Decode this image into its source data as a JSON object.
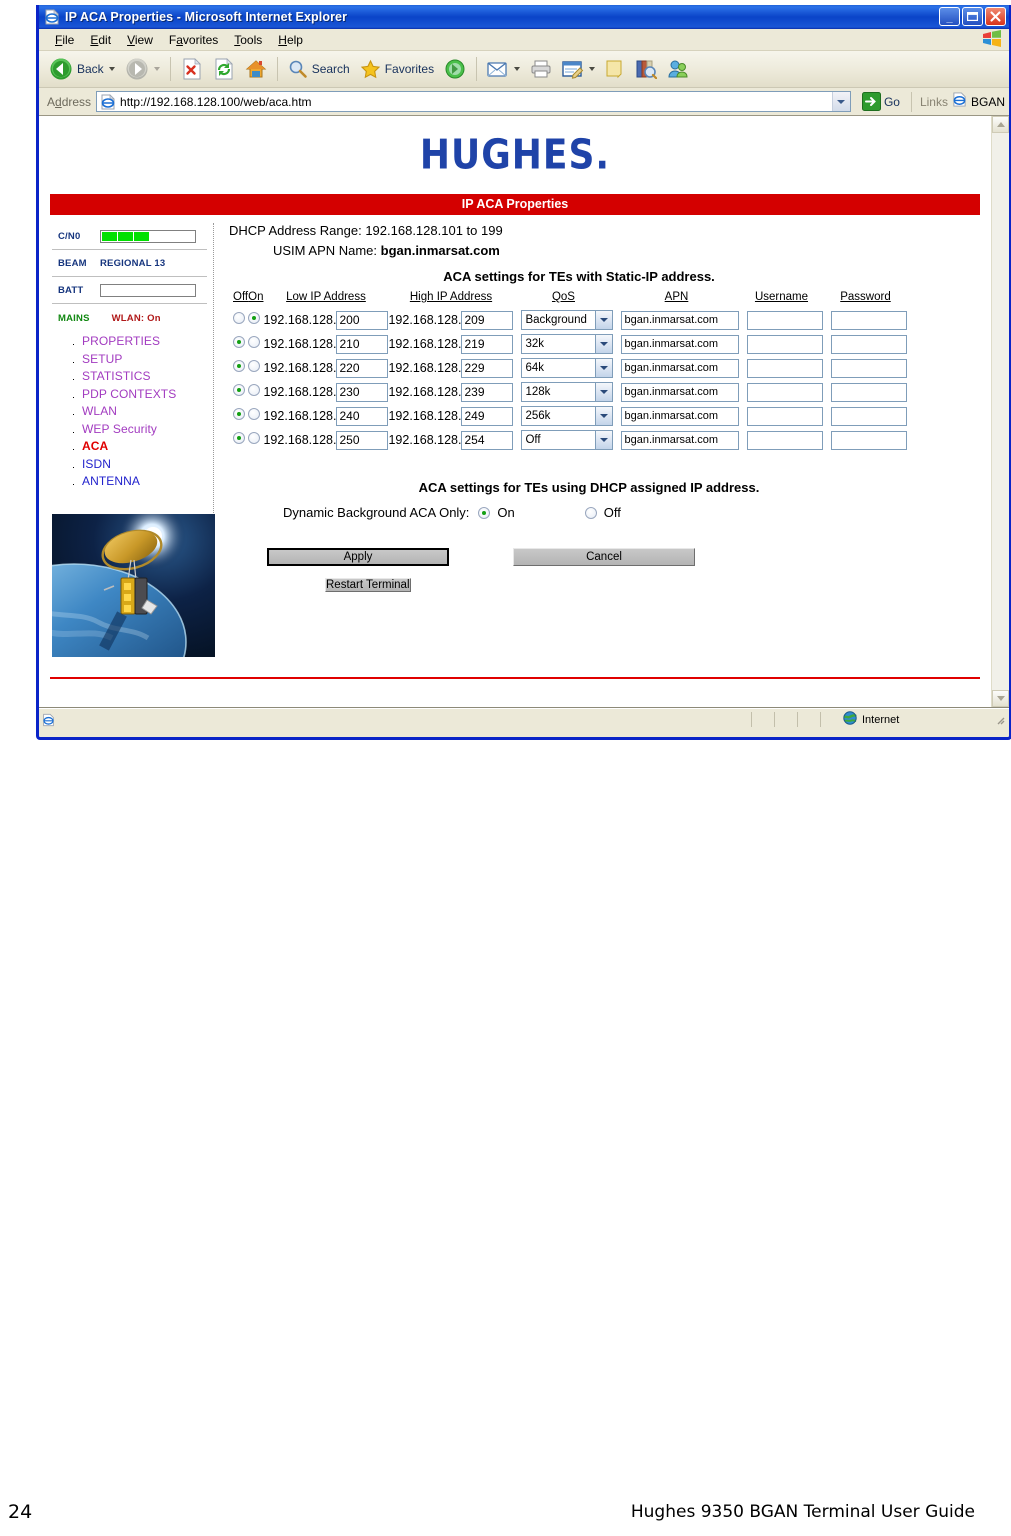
{
  "window": {
    "title": "IP ACA Properties - Microsoft Internet Explorer",
    "minimize_label": "_",
    "maximize_label": "❐",
    "close_label": "✕"
  },
  "menu": {
    "items": [
      {
        "label": "File"
      },
      {
        "label": "Edit"
      },
      {
        "label": "View"
      },
      {
        "label": "Favorites"
      },
      {
        "label": "Tools"
      },
      {
        "label": "Help"
      }
    ]
  },
  "toolbar": {
    "back_label": "Back",
    "forward_label": "",
    "stop_label": "",
    "refresh_label": "",
    "home_label": "",
    "search_label": "Search",
    "favorites_label": "Favorites",
    "media_label": "",
    "history_label": "",
    "mail_label": "",
    "print_label": "",
    "edit_label": "",
    "discuss_label": "",
    "research_label": "",
    "messenger_label": ""
  },
  "address": {
    "label": "Address",
    "url": "http://192.168.128.100/web/aca.htm",
    "go_label": "Go",
    "links_label": "Links",
    "link_bgan": "BGAN"
  },
  "statusbar": {
    "text": "",
    "zone": "Internet"
  },
  "page": {
    "logo": "HUGHES.",
    "banner_title": "IP ACA Properties",
    "dhcp_range_label": "DHCP Address Range: 192.168.128.101 to 199",
    "usim_apn_label": "USIM APN Name:",
    "usim_apn_value": "bgan.inmarsat.com",
    "static_section_title": "ACA settings for TEs with Static-IP address.",
    "dhcp_section_title": "ACA settings for TEs using DHCP assigned IP address.",
    "dynamic_label": "Dynamic Background ACA Only:",
    "dynamic_on_label": "On",
    "dynamic_off_label": "Off",
    "dynamic_selected": "On",
    "apply_label": "Apply",
    "cancel_label": "Cancel",
    "restart_label": "Restart Terminal"
  },
  "sidebar": {
    "cn0_label": "C/N0",
    "cn0_bars": 3,
    "cn0_total_bars": 6,
    "beam_label": "BEAM",
    "beam_value": "REGIONAL 13",
    "batt_label": "BATT",
    "batt_value": "",
    "mains_label": "MAINS",
    "wlan_label": "WLAN: On",
    "nav": [
      {
        "label": "PROPERTIES",
        "state": "visited"
      },
      {
        "label": "SETUP",
        "state": "visited"
      },
      {
        "label": "STATISTICS",
        "state": "visited"
      },
      {
        "label": "PDP CONTEXTS",
        "state": "visited"
      },
      {
        "label": "WLAN",
        "state": "visited"
      },
      {
        "label": "WEP Security",
        "state": "visited"
      },
      {
        "label": "ACA",
        "state": "current"
      },
      {
        "label": "ISDN",
        "state": "link"
      },
      {
        "label": "ANTENNA",
        "state": "link"
      }
    ]
  },
  "table": {
    "headers": {
      "off": "Off",
      "on": "On",
      "low_ip": "Low IP Address",
      "high_ip": "High IP Address",
      "qos": "QoS",
      "apn": "APN",
      "username": "Username",
      "password": "Password"
    },
    "ip_prefix": "192.168.128.",
    "rows": [
      {
        "selected": "On",
        "low": "200",
        "high": "209",
        "qos": "Background",
        "apn": "bgan.inmarsat.com",
        "username": "",
        "password": ""
      },
      {
        "selected": "Off",
        "low": "210",
        "high": "219",
        "qos": "32k",
        "apn": "bgan.inmarsat.com",
        "username": "",
        "password": ""
      },
      {
        "selected": "Off",
        "low": "220",
        "high": "229",
        "qos": "64k",
        "apn": "bgan.inmarsat.com",
        "username": "",
        "password": ""
      },
      {
        "selected": "Off",
        "low": "230",
        "high": "239",
        "qos": "128k",
        "apn": "bgan.inmarsat.com",
        "username": "",
        "password": ""
      },
      {
        "selected": "Off",
        "low": "240",
        "high": "249",
        "qos": "256k",
        "apn": "bgan.inmarsat.com",
        "username": "",
        "password": ""
      },
      {
        "selected": "Off",
        "low": "250",
        "high": "254",
        "qos": "Off",
        "apn": "bgan.inmarsat.com",
        "username": "",
        "password": ""
      }
    ]
  },
  "document": {
    "page_number": "24",
    "footer": "Hughes 9350 BGAN Terminal User Guide"
  },
  "colors": {
    "banner_red": "#D40000",
    "logo_blue": "#1F43A8",
    "link_visited": "#A23BC0",
    "link_blue": "#2222CC",
    "current_red": "#E00000",
    "signal_green": "#00E000",
    "title_blue": "#0A44C8"
  }
}
